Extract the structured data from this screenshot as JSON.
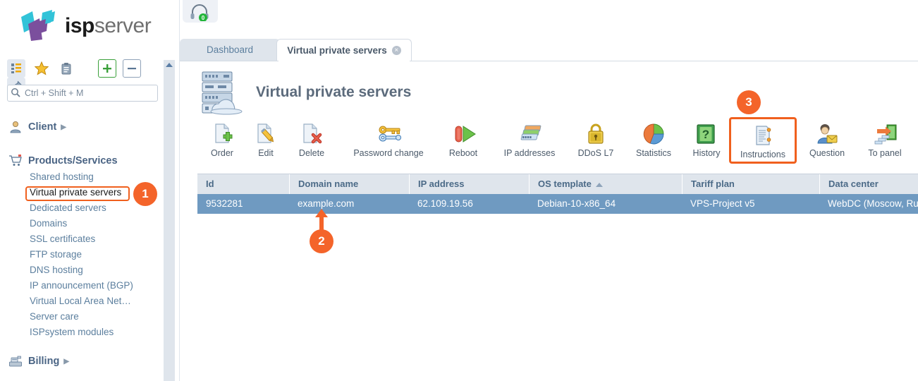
{
  "brand": {
    "name_bold": "isp",
    "name_light": "server",
    "logo_colors": [
      "#32c3d8",
      "#7b4f9d"
    ]
  },
  "sidebar": {
    "tools": [
      {
        "name": "tree-view-icon",
        "title": "Tree view"
      },
      {
        "name": "favorites-star-icon",
        "title": "Favorites"
      },
      {
        "name": "clipboard-icon",
        "title": "Clipboard"
      },
      {
        "name": "expand-all-icon",
        "title": "Expand all"
      },
      {
        "name": "collapse-all-icon",
        "title": "Collapse all"
      },
      {
        "name": "pin-icon",
        "title": "Pin menu"
      }
    ],
    "search": {
      "placeholder": "Ctrl + Shift + M",
      "value": ""
    },
    "groups": [
      {
        "label": "Client",
        "icon": "user-icon",
        "has_arrow": true,
        "items": []
      },
      {
        "label": "Products/Services",
        "icon": "cart-icon",
        "has_arrow": false,
        "items": [
          {
            "label": "Shared hosting",
            "highlighted": false
          },
          {
            "label": "Virtual private servers",
            "highlighted": true
          },
          {
            "label": "Dedicated servers",
            "highlighted": false
          },
          {
            "label": "Domains",
            "highlighted": false
          },
          {
            "label": "SSL certificates",
            "highlighted": false
          },
          {
            "label": "FTP storage",
            "highlighted": false
          },
          {
            "label": "DNS hosting",
            "highlighted": false
          },
          {
            "label": "IP announcement (BGP)",
            "highlighted": false
          },
          {
            "label": "Virtual Local Area Net…",
            "highlighted": false
          },
          {
            "label": "Server care",
            "highlighted": false
          },
          {
            "label": "ISPsystem modules",
            "highlighted": false
          }
        ]
      },
      {
        "label": "Billing",
        "icon": "cash-register-icon",
        "has_arrow": true,
        "items": []
      }
    ]
  },
  "main": {
    "support_button": {
      "name": "headset-icon",
      "badge": "0"
    },
    "tabs": [
      {
        "label": "Dashboard",
        "active": false,
        "closable": false
      },
      {
        "label": "Virtual private servers",
        "active": true,
        "closable": true,
        "close_glyph": "×"
      }
    ],
    "page_title": "Virtual private servers",
    "page_icon": "server-cloud-icon",
    "toolbar": [
      {
        "label": "Order",
        "icon": "page-add-icon",
        "highlighted": false
      },
      {
        "label": "Edit",
        "icon": "page-edit-icon",
        "highlighted": false
      },
      {
        "label": "Delete",
        "icon": "page-delete-icon",
        "highlighted": false
      },
      {
        "label": "Password change",
        "icon": "key-icon",
        "highlighted": false
      },
      {
        "label": "Reboot",
        "icon": "power-restart-icon",
        "highlighted": false
      },
      {
        "label": "IP addresses",
        "icon": "ip-stack-icon",
        "highlighted": false
      },
      {
        "label": "DDoS L7",
        "icon": "lock-icon",
        "highlighted": false
      },
      {
        "label": "Statistics",
        "icon": "pie-chart-icon",
        "highlighted": false
      },
      {
        "label": "History",
        "icon": "book-help-icon",
        "highlighted": false
      },
      {
        "label": "Instructions",
        "icon": "document-scroll-icon",
        "highlighted": true
      },
      {
        "label": "Question",
        "icon": "user-message-icon",
        "highlighted": false
      },
      {
        "label": "To panel",
        "icon": "enter-panel-icon",
        "highlighted": false
      }
    ],
    "table": {
      "columns": [
        {
          "label": "Id",
          "sort": null
        },
        {
          "label": "Domain name",
          "sort": null
        },
        {
          "label": "IP address",
          "sort": null
        },
        {
          "label": "OS template",
          "sort": "asc"
        },
        {
          "label": "Tariff plan",
          "sort": null
        },
        {
          "label": "Data center",
          "sort": null
        }
      ],
      "rows": [
        {
          "selected": true,
          "cells": [
            "9532281",
            "example.com",
            "62.109.19.56",
            "Debian-10-x86_64",
            "VPS-Project v5",
            "WebDC (Moscow, Russ"
          ]
        }
      ]
    }
  },
  "annotations": {
    "accent_color": "#f4642a",
    "markers": [
      {
        "number": "1",
        "target": "sidebar-item-virtual-private-servers"
      },
      {
        "number": "2",
        "target": "table-cell-domain-name"
      },
      {
        "number": "3",
        "target": "toolbar-instructions"
      }
    ]
  }
}
